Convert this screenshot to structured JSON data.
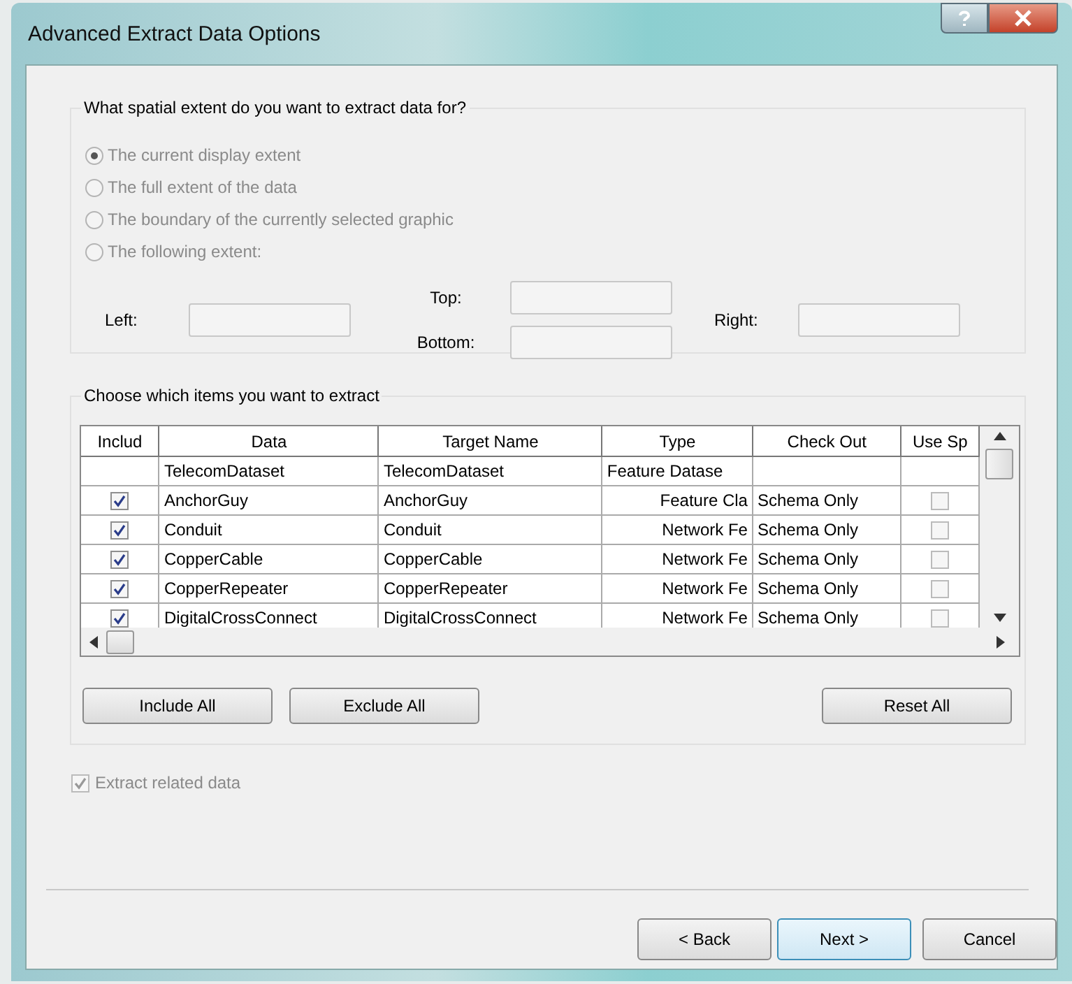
{
  "window": {
    "title": "Advanced Extract Data Options"
  },
  "extent_group": {
    "legend": "What spatial extent do you want to extract data for?",
    "options": [
      {
        "label": "The current display extent",
        "selected": true,
        "disabled": true
      },
      {
        "label": "The full extent of the data",
        "selected": false,
        "disabled": true
      },
      {
        "label": "The boundary of the currently selected graphic",
        "selected": false,
        "disabled": true
      },
      {
        "label": "The following extent:",
        "selected": false,
        "disabled": true
      }
    ],
    "fields": {
      "left": "Left:",
      "top": "Top:",
      "bottom": "Bottom:",
      "right": "Right:"
    }
  },
  "items_group": {
    "legend": "Choose which items you want to extract",
    "columns": [
      "Includ",
      "Data",
      "Target Name",
      "Type",
      "Check Out",
      "Use Sp"
    ],
    "rows": [
      {
        "kind": "dataset",
        "data": "TelecomDataset",
        "target": "TelecomDataset",
        "type": "Feature Datase"
      },
      {
        "kind": "class",
        "include": true,
        "data": "AnchorGuy",
        "target": "AnchorGuy",
        "type": "Feature Cla",
        "check_out": "Schema Only",
        "use_sp": false
      },
      {
        "kind": "class",
        "include": true,
        "data": "Conduit",
        "target": "Conduit",
        "type": "Network Fe",
        "check_out": "Schema Only",
        "use_sp": false
      },
      {
        "kind": "class",
        "include": true,
        "data": "CopperCable",
        "target": "CopperCable",
        "type": "Network Fe",
        "check_out": "Schema Only",
        "use_sp": false
      },
      {
        "kind": "class",
        "include": true,
        "data": "CopperRepeater",
        "target": "CopperRepeater",
        "type": "Network Fe",
        "check_out": "Schema Only",
        "use_sp": false
      },
      {
        "kind": "class",
        "include": true,
        "data": "DigitalCrossConnect",
        "target": "DigitalCrossConnect",
        "type": "Network Fe",
        "check_out": "Schema Only",
        "use_sp": false
      }
    ],
    "buttons": [
      "Include All",
      "Exclude All",
      "Reset All"
    ]
  },
  "related": {
    "label": "Extract related data",
    "checked": true,
    "disabled": true
  },
  "footer_buttons": [
    {
      "label": "< Back",
      "default": false
    },
    {
      "label": "Next >",
      "default": true
    },
    {
      "label": "Cancel",
      "default": false
    }
  ]
}
